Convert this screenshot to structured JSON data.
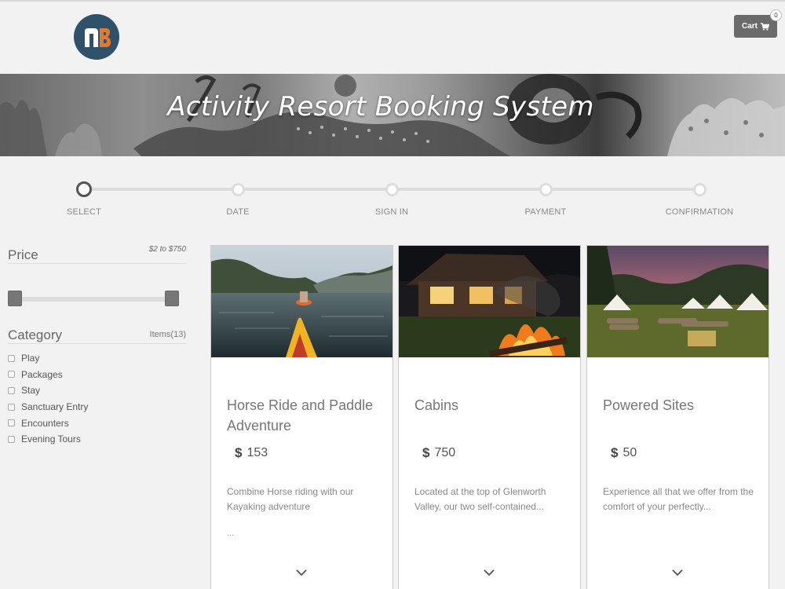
{
  "header": {
    "logo_icon": "nb-logo",
    "cart_label": "Cart",
    "cart_icon": "shopping-cart-icon",
    "cart_count": "0"
  },
  "banner": {
    "title": "Activity Resort Booking System"
  },
  "steps": [
    {
      "label": "SELECT",
      "active": true
    },
    {
      "label": "DATE",
      "active": false
    },
    {
      "label": "SIGN IN",
      "active": false
    },
    {
      "label": "PAYMENT",
      "active": false
    },
    {
      "label": "CONFIRMATION",
      "active": false
    }
  ],
  "sidebar": {
    "price": {
      "heading": "Price",
      "range": "$2 to $750"
    },
    "category": {
      "heading": "Category",
      "count": "Items(13)",
      "items": [
        {
          "label": "Play"
        },
        {
          "label": "Packages"
        },
        {
          "label": "Stay"
        },
        {
          "label": "Sanctuary Entry"
        },
        {
          "label": "Encounters"
        },
        {
          "label": "Evening Tours"
        }
      ]
    }
  },
  "cards": [
    {
      "title": "Horse Ride and Paddle Adventure",
      "currency": "$",
      "price": "153",
      "description": "Combine Horse riding with our Kayaking adventure",
      "more": "..."
    },
    {
      "title": "Cabins",
      "currency": "$",
      "price": "750",
      "description": "Located at the top of Glenworth Valley, our two self-contained...",
      "more": ""
    },
    {
      "title": "Powered Sites",
      "currency": "$",
      "price": "50",
      "description": "Experience all that we offer from the comfort of your perfectly...",
      "more": ""
    }
  ],
  "colors": {
    "logo_bg": "#2f5169",
    "logo_accent": "#e07a2e",
    "cart_bg": "#6b6b6b",
    "active_step": "#555555"
  }
}
